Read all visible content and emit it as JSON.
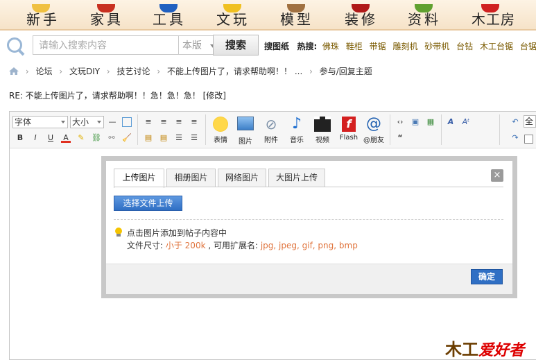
{
  "nav": {
    "items": [
      {
        "label": "新手",
        "color": "#f0c040"
      },
      {
        "label": "家具",
        "color": "#c83020"
      },
      {
        "label": "工具",
        "color": "#2060c0"
      },
      {
        "label": "文玩",
        "color": "#f0c020"
      },
      {
        "label": "模型",
        "color": "#a07040"
      },
      {
        "label": "装修",
        "color": "#b01818"
      },
      {
        "label": "资料",
        "color": "#60a030"
      },
      {
        "label": "木工房",
        "color": "#d02020"
      }
    ]
  },
  "search": {
    "placeholder": "请输入搜索内容",
    "scope": "本版",
    "button": "搜索",
    "image_search": "搜图纸",
    "hot_label": "热搜:",
    "hot_terms": [
      "佛珠",
      "鞋柜",
      "带锯",
      "雕刻机",
      "砂带机",
      "台钻",
      "木工台锯",
      "台锯"
    ]
  },
  "breadcrumb": {
    "items": [
      "论坛",
      "文玩DIY",
      "技艺讨论",
      "不能上传图片了，请求帮助啊！！ ...",
      "参与/回复主题"
    ]
  },
  "reply_title": "RE: 不能上传图片了，请求帮助啊！！急！急！急！ [修改]",
  "toolbar": {
    "font_select": "字体",
    "size_select": "大小",
    "tools": [
      "表情",
      "图片",
      "附件",
      "音乐",
      "视频",
      "Flash",
      "@朋友"
    ],
    "fullscreen_label": "全"
  },
  "dialog": {
    "tabs": [
      "上传图片",
      "相册图片",
      "网络图片",
      "大图片上传"
    ],
    "close": "×",
    "choose_button": "选择文件上传",
    "tip_line1": "点击图片添加到帖子内容中",
    "tip_size_prefix": "文件尺寸: ",
    "tip_size_value": "小于 200k",
    "tip_ext_prefix": " , 可用扩展名: ",
    "tip_ext_value": "jpg, jpeg, gif, png, bmp",
    "ok_button": "确定"
  },
  "logo": {
    "wood": "木工",
    "aihao": "爱好者"
  }
}
